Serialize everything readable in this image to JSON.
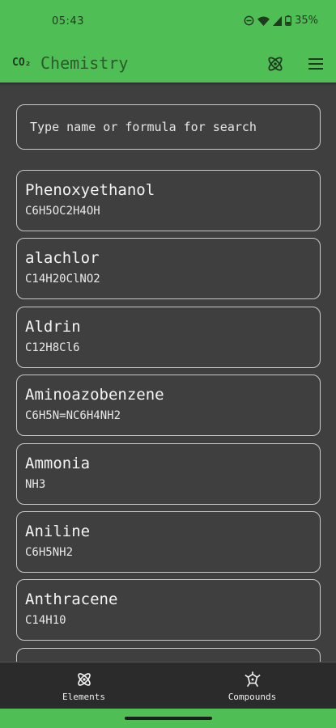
{
  "status_bar": {
    "time": "05:43",
    "battery": "35%",
    "icons": [
      "do-not-disturb-icon",
      "wifi-icon",
      "cell-signal-icon",
      "battery-icon"
    ]
  },
  "app_bar": {
    "logo": "CO₂",
    "title": "Chemistry",
    "actions": [
      "atom-icon",
      "menu-icon"
    ]
  },
  "search": {
    "placeholder": "Type name or formula for search",
    "value": ""
  },
  "compounds": [
    {
      "name": "Phenoxyethanol",
      "formula": "C6H5OC2H4OH"
    },
    {
      "name": "alachlor",
      "formula": "C14H20ClNO2"
    },
    {
      "name": "Aldrin",
      "formula": "C12H8Cl6"
    },
    {
      "name": "Aminoazobenzene",
      "formula": "C6H5N=NC6H4NH2"
    },
    {
      "name": "Ammonia",
      "formula": "NH3"
    },
    {
      "name": "Aniline",
      "formula": "C6H5NH2"
    },
    {
      "name": "Anthracene",
      "formula": "C14H10"
    },
    {
      "name": "",
      "formula": ""
    }
  ],
  "bottom_nav": {
    "items": [
      {
        "label": "Elements",
        "icon": "atom-icon"
      },
      {
        "label": "Compounds",
        "icon": "molecule-icon"
      }
    ]
  },
  "colors": {
    "accent": "#4fbf55",
    "background": "#3f3f3f",
    "nav_background": "#2b2b2b"
  }
}
